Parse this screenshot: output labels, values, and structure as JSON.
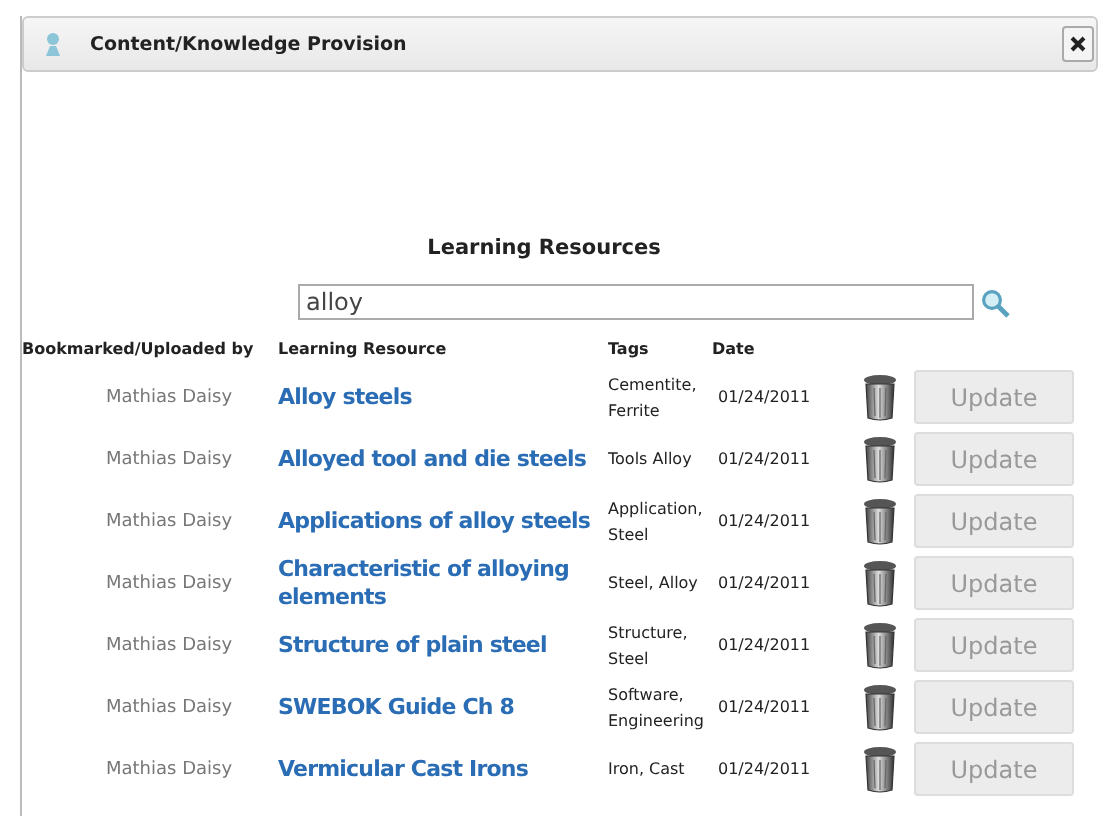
{
  "window": {
    "title": "Content/Knowledge Provision"
  },
  "heading": "Learning Resources",
  "search": {
    "value": "alloy"
  },
  "columns": [
    "Bookmarked/Uploaded by",
    "Learning Resource",
    "Tags",
    "Date"
  ],
  "rows": [
    {
      "author": "Mathias Daisy",
      "resource": "Alloy steels",
      "tags": "Cementite, Ferrite",
      "date": "01/24/2011",
      "action": "Update"
    },
    {
      "author": "Mathias Daisy",
      "resource": "Alloyed tool and die steels",
      "tags": "Tools Alloy",
      "date": "01/24/2011",
      "action": "Update"
    },
    {
      "author": "Mathias Daisy",
      "resource": "Applications of alloy steels",
      "tags": "Application, Steel",
      "date": "01/24/2011",
      "action": "Update"
    },
    {
      "author": "Mathias Daisy",
      "resource": "Characteristic of alloying elements",
      "tags": "Steel, Alloy",
      "date": "01/24/2011",
      "action": "Update"
    },
    {
      "author": "Mathias Daisy",
      "resource": "Structure of plain steel",
      "tags": "Structure, Steel",
      "date": "01/24/2011",
      "action": "Update"
    },
    {
      "author": "Mathias Daisy",
      "resource": "SWEBOK Guide Ch 8",
      "tags": "Software, Engineering",
      "date": "01/24/2011",
      "action": "Update"
    },
    {
      "author": "Mathias Daisy",
      "resource": "Vermicular Cast Irons",
      "tags": "Iron, Cast",
      "date": "01/24/2011",
      "action": "Update"
    }
  ]
}
